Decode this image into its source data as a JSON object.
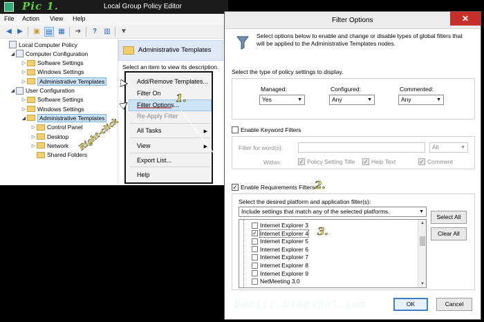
{
  "annotations": {
    "pic_label": "Pic 1.",
    "right_click": "Right-click",
    "step1": "1.",
    "step2": "2.",
    "step3": "3.",
    "watermark": "booiii.blogspot.com"
  },
  "gpe": {
    "title": "Local Group Policy Editor",
    "menu": [
      "File",
      "Action",
      "View",
      "Help"
    ],
    "tree": [
      {
        "label": "Local Computer Policy",
        "level": 0,
        "icon": "policy-icon",
        "expander": ""
      },
      {
        "label": "Computer Configuration",
        "level": 1,
        "icon": "computer-icon",
        "expander": "◢"
      },
      {
        "label": "Software Settings",
        "level": 2,
        "icon": "folder-icon",
        "expander": "▷"
      },
      {
        "label": "Windows Settings",
        "level": 2,
        "icon": "folder-icon",
        "expander": "▷"
      },
      {
        "label": "Administrative Templates",
        "level": 2,
        "icon": "folder-icon",
        "expander": "▷",
        "selected": true
      },
      {
        "label": "User Configuration",
        "level": 1,
        "icon": "user-icon",
        "expander": "◢"
      },
      {
        "label": "Software Settings",
        "level": 2,
        "icon": "folder-icon",
        "expander": "▷"
      },
      {
        "label": "Windows Settings",
        "level": 2,
        "icon": "folder-icon",
        "expander": "▷"
      },
      {
        "label": "Administrative Templates",
        "level": 2,
        "icon": "folder-icon",
        "expander": "◢",
        "selected": true
      },
      {
        "label": "Control Panel",
        "level": 3,
        "icon": "folder-icon",
        "expander": "▷"
      },
      {
        "label": "Desktop",
        "level": 3,
        "icon": "folder-icon",
        "expander": "▷"
      },
      {
        "label": "Network",
        "level": 3,
        "icon": "folder-icon",
        "expander": "▷"
      },
      {
        "label": "Shared Folders",
        "level": 3,
        "icon": "folder-icon",
        "expander": ""
      }
    ],
    "pane_header": "Administrative Templates",
    "pane_desc": "Select an item to view its description.",
    "context_menu": {
      "add_remove": "Add/Remove Templates...",
      "filter_on": "Filter On",
      "filter_options": "Filter Options...",
      "reapply": "Re-Apply Filter",
      "all_tasks": "All Tasks",
      "view": "View",
      "export": "Export List...",
      "help": "Help"
    }
  },
  "dialog": {
    "title": "Filter Options",
    "close": "✕",
    "intro": "Select options below to enable and change or disable types of global filters that will be applied to the Administrative Templates nodes.",
    "policy_type_label": "Select the type of policy settings to display.",
    "managed_label": "Managed:",
    "managed_value": "Yes",
    "configured_label": "Configured:",
    "configured_value": "Any",
    "commented_label": "Commented:",
    "commented_value": "Any",
    "keyword_label": "Enable Keyword Filters",
    "keyword_checked": false,
    "filter_words_label": "Filter for word(s):",
    "filter_words_value": "",
    "filter_words_mode": "All",
    "within_label": "Within:",
    "within_policy_title": "Policy Setting Title",
    "within_help_text": "Help Text",
    "within_comment": "Comment",
    "requirements_label": "Enable Requirements Filters",
    "requirements_checked": true,
    "platform_label": "Select the desired platform and application filter(s):",
    "platform_mode": "Include settings that match any of the selected platforms.",
    "platforms": [
      {
        "label": "Internet Explorer 3",
        "checked": false
      },
      {
        "label": "Internet Explorer 4",
        "checked": true
      },
      {
        "label": "Internet Explorer 5",
        "checked": false
      },
      {
        "label": "Internet Explorer 6",
        "checked": false
      },
      {
        "label": "Internet Explorer 7",
        "checked": false
      },
      {
        "label": "Internet Explorer 8",
        "checked": false
      },
      {
        "label": "Internet Explorer 9",
        "checked": false
      },
      {
        "label": "NetMeeting 3.0",
        "checked": false
      }
    ],
    "select_all": "Select All",
    "clear_all": "Clear All",
    "ok": "OK",
    "cancel": "Cancel"
  }
}
